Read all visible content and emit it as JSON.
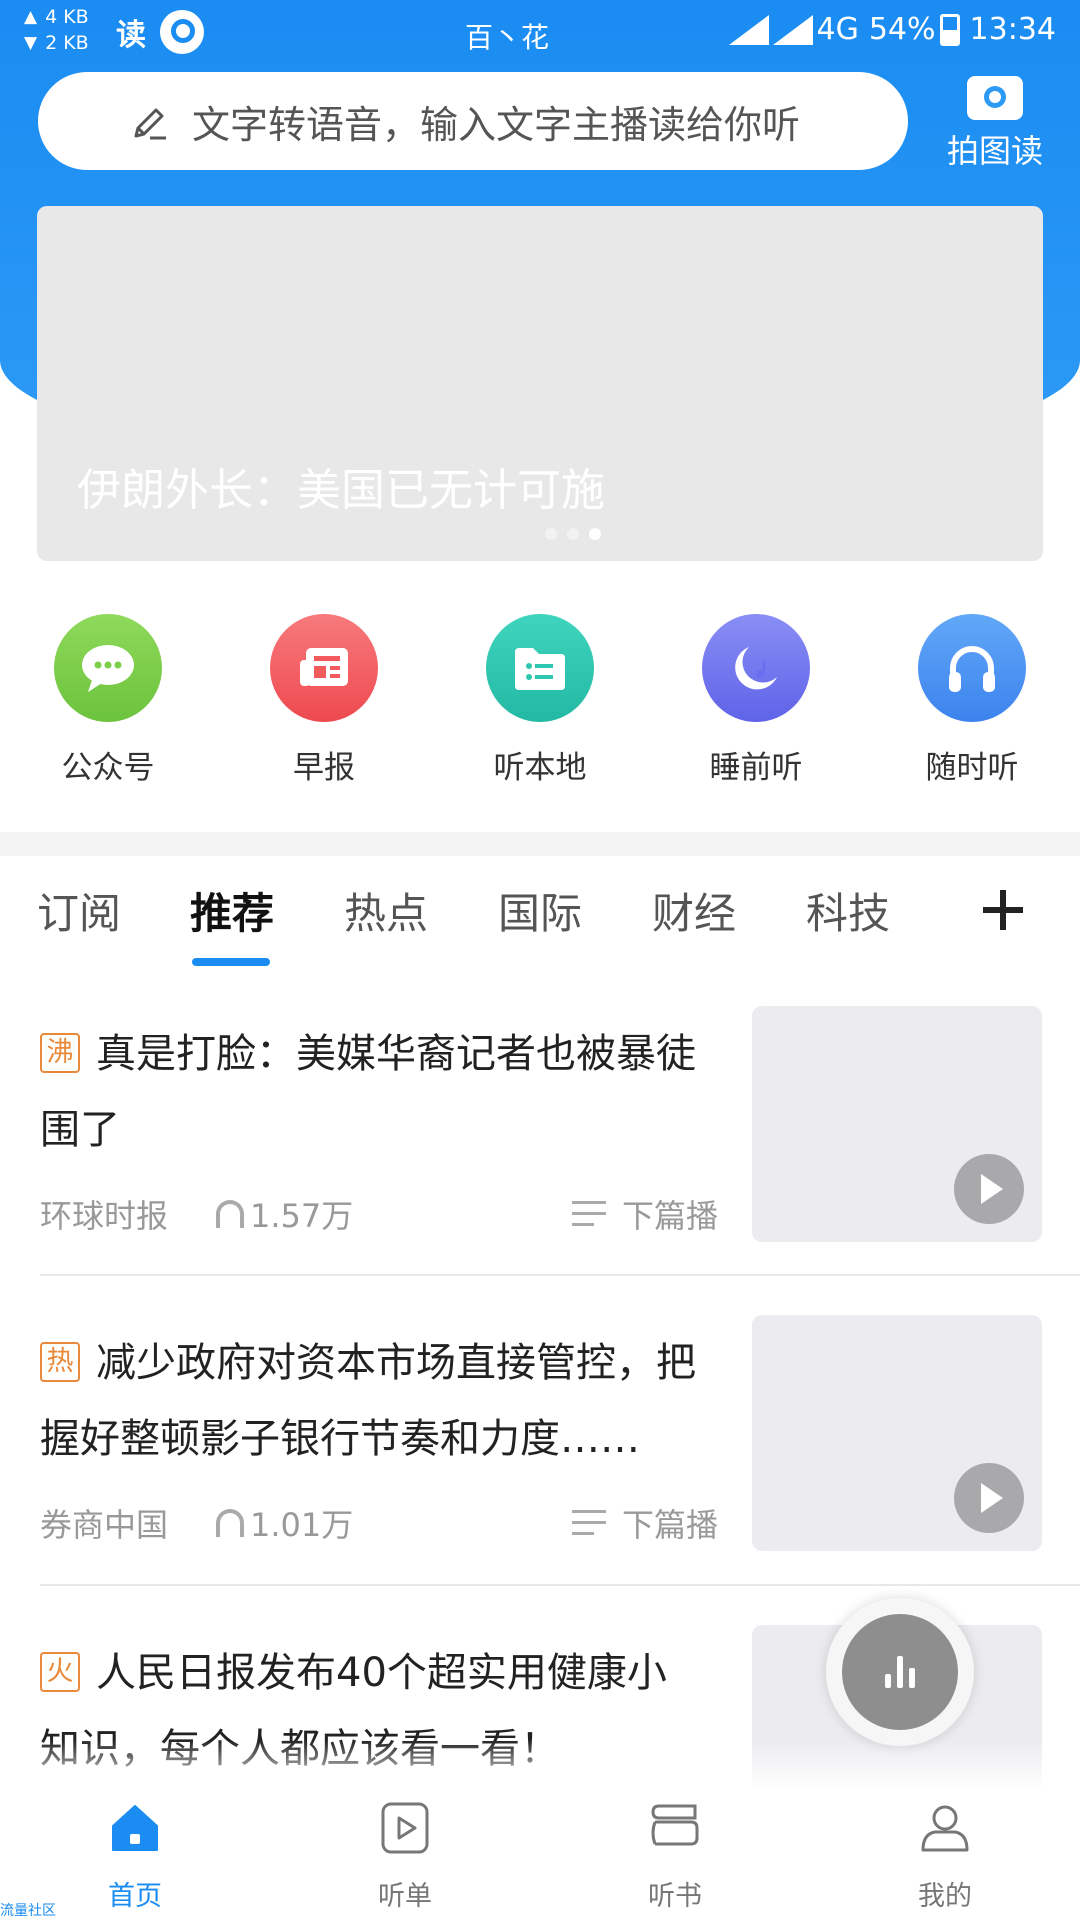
{
  "status_bar": {
    "upload_speed": "4 KB",
    "download_speed": "2 KB",
    "app_glyph": "读",
    "carrier": "百丶花",
    "network": "4G",
    "battery": "54%",
    "time": "13:34"
  },
  "search": {
    "placeholder": "文字转语音，输入文字主播读给你听"
  },
  "photo_read": {
    "label": "拍图读",
    "icon": "camera-icon"
  },
  "banner": {
    "title": "伊朗外长：美国已无计可施",
    "slides": 3,
    "active_slide": 3
  },
  "quick_actions": [
    {
      "label": "公众号",
      "icon": "wechat-chat-icon",
      "color": "#7ccf4a"
    },
    {
      "label": "早报",
      "icon": "newspaper-icon",
      "color": "#f25a5e"
    },
    {
      "label": "听本地",
      "icon": "folder-list-icon",
      "color": "#2fc6b0"
    },
    {
      "label": "睡前听",
      "icon": "moon-icon",
      "color": "#7076f0"
    },
    {
      "label": "随时听",
      "icon": "headphones-icon",
      "color": "#4d94f2"
    }
  ],
  "tabs": [
    "订阅",
    "推荐",
    "热点",
    "国际",
    "财经",
    "科技"
  ],
  "active_tab": "推荐",
  "news": [
    {
      "tag": "沸",
      "title": "真是打脸：美媒华裔记者也被暴徒围了",
      "source": "环球时报",
      "plays": "1.57万",
      "next_label": "下篇播"
    },
    {
      "tag": "热",
      "title": "减少政府对资本市场直接管控，把握好整顿影子银行节奏和力度……",
      "source": "券商中国",
      "plays": "1.01万",
      "next_label": "下篇播"
    },
    {
      "tag": "火",
      "title": "人民日报发布40个超实用健康小知识，每个人都应该看一看！"
    }
  ],
  "bottom_nav": [
    {
      "label": "首页",
      "icon": "home-icon",
      "active": true
    },
    {
      "label": "听单",
      "icon": "playlist-icon",
      "active": false
    },
    {
      "label": "听书",
      "icon": "book-icon",
      "active": false
    },
    {
      "label": "我的",
      "icon": "profile-icon",
      "active": false
    }
  ],
  "accent_color": "#1a8cf2",
  "watermark": "流量社区"
}
